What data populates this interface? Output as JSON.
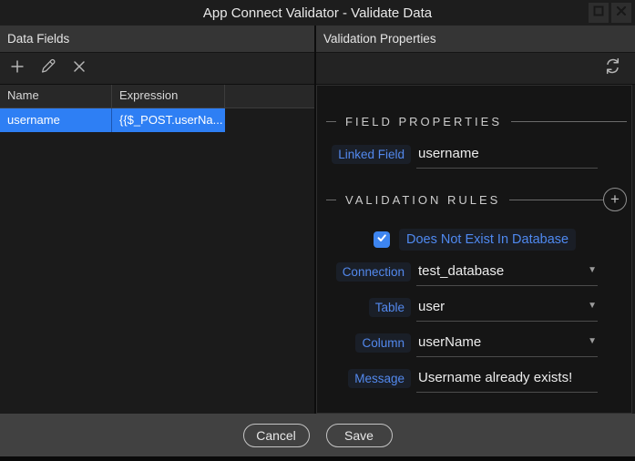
{
  "window": {
    "title": "App Connect Validator - Validate Data"
  },
  "icons": {
    "add": "plus",
    "edit": "pencil",
    "delete": "x",
    "refresh": "circular-arrows",
    "maximize": "square-outline",
    "close": "x",
    "dropdown": "▼",
    "add_rule": "+",
    "check": "checkmark"
  },
  "colors": {
    "selection_blue": "#2e7ff4",
    "label_blue": "#5389ee",
    "checkbox_blue": "#3d85f0",
    "panel_bg": "#151515",
    "header_bg": "#353535"
  },
  "left_panel": {
    "header": "Data Fields",
    "table": {
      "columns": [
        "Name",
        "Expression"
      ],
      "rows": [
        {
          "name": "username",
          "expression": "{{$_POST.userNa...",
          "selected": true
        }
      ]
    }
  },
  "right_panel": {
    "header": "Validation Properties",
    "field_properties": {
      "title": "FIELD PROPERTIES",
      "fields": [
        {
          "label": "Linked Field",
          "value": "username",
          "type": "text"
        }
      ]
    },
    "validation_rules": {
      "title": "VALIDATION RULES",
      "rule": {
        "checked": true,
        "label": "Does Not Exist In Database"
      },
      "fields": [
        {
          "label": "Connection",
          "value": "test_database",
          "type": "select"
        },
        {
          "label": "Table",
          "value": "user",
          "type": "select"
        },
        {
          "label": "Column",
          "value": "userName",
          "type": "select"
        },
        {
          "label": "Message",
          "value": "Username already exists!",
          "type": "text"
        }
      ]
    }
  },
  "footer": {
    "cancel_label": "Cancel",
    "save_label": "Save"
  }
}
